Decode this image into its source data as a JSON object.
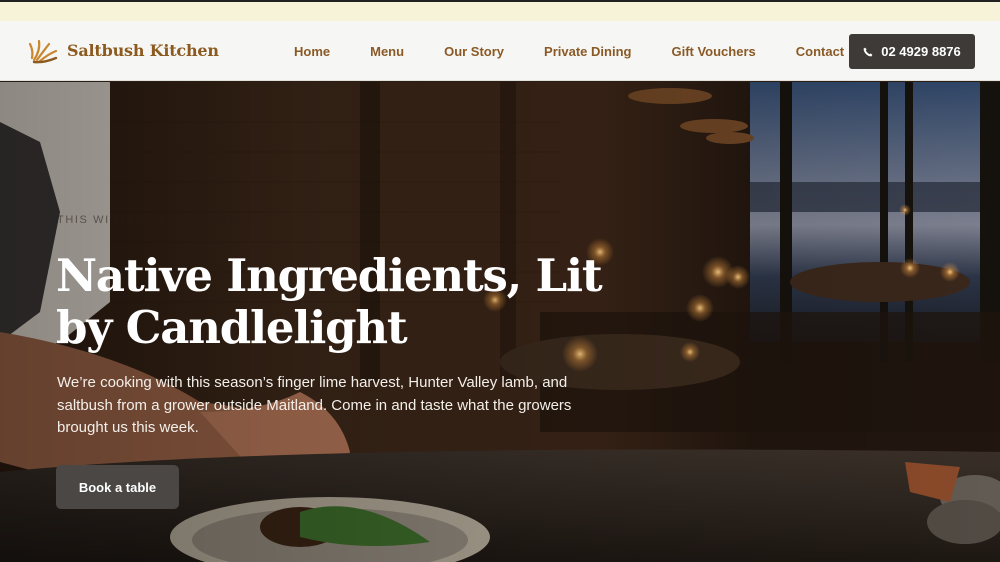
{
  "brand": {
    "name": "Saltbush Kitchen",
    "icon": "saltbush-leaf-icon",
    "color": "#8c5a1f"
  },
  "nav": {
    "items": [
      {
        "label": "Home"
      },
      {
        "label": "Menu"
      },
      {
        "label": "Our Story"
      },
      {
        "label": "Private Dining"
      },
      {
        "label": "Gift Vouchers"
      },
      {
        "label": "Contact"
      }
    ],
    "phone_label": "02 4929 8876",
    "phone_icon": "phone-icon"
  },
  "hero": {
    "eyebrow": "This winter in Newcastle",
    "headline": "Native Ingredients, Lit by Candlelight",
    "body": "We’re cooking with this season’s finger lime harvest, Hunter Valley lamb, and saltbush from a grower outside Maitland. Come in and taste what the growers brought us this week.",
    "cta_label": "Book a table"
  },
  "colors": {
    "accent": "#8a5a26",
    "button_dark": "#3d3a37",
    "strip": "#f6f3d8"
  }
}
